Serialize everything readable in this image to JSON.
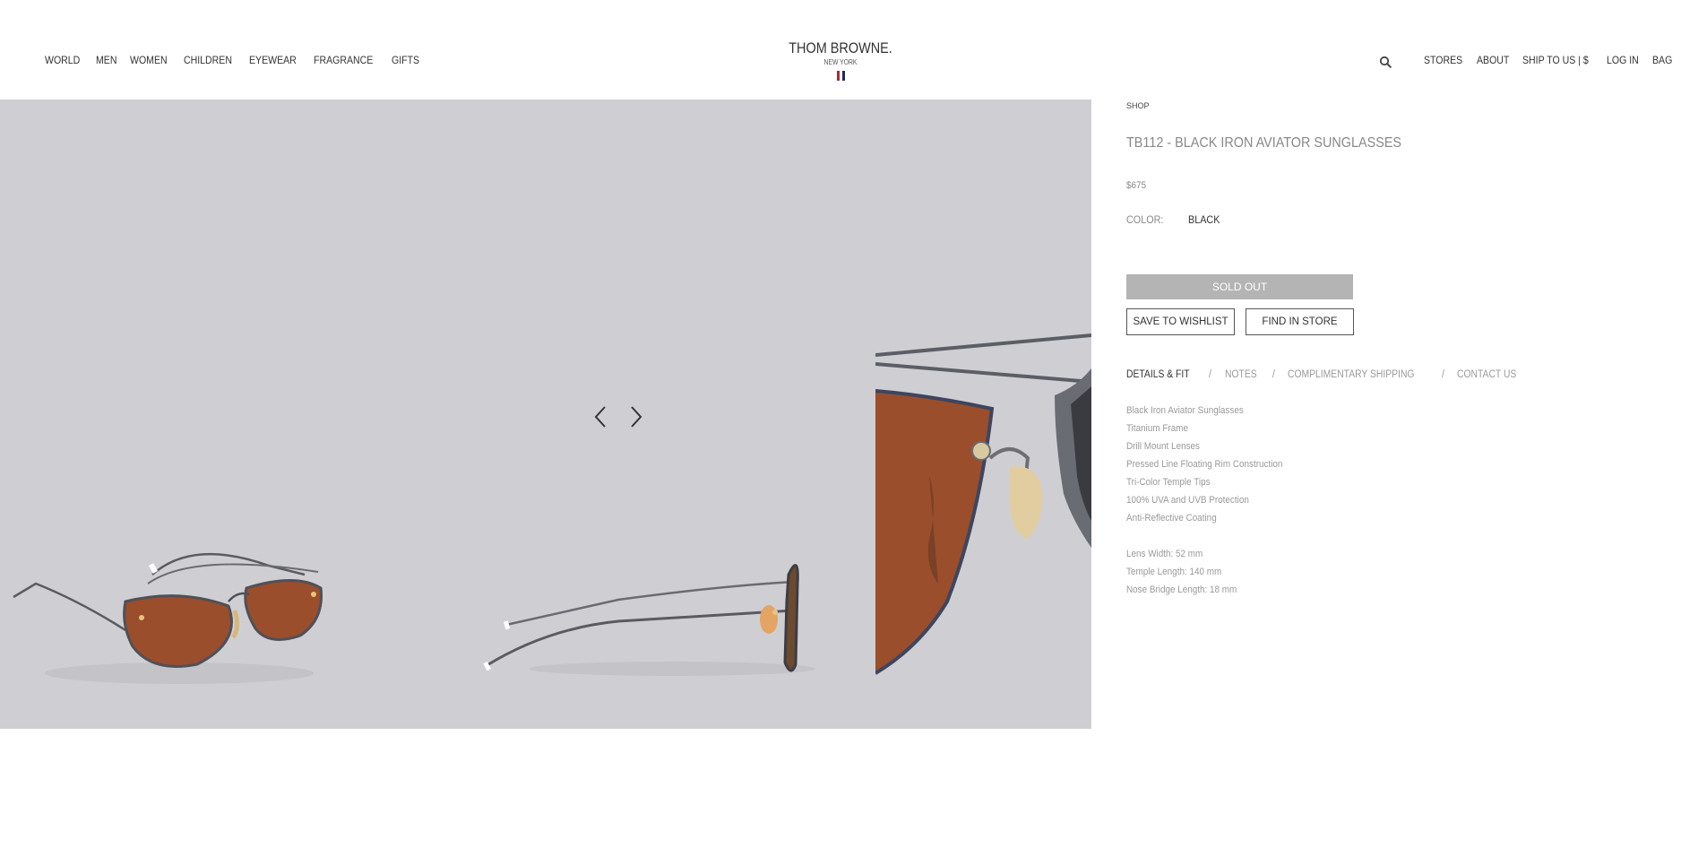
{
  "header": {
    "nav_left": [
      "WORLD",
      "MEN",
      "WOMEN",
      "CHILDREN",
      "EYEWEAR",
      "FRAGRANCE",
      "GIFTS"
    ],
    "logo_name": "THOM BROWNE.",
    "logo_sub": "NEW YORK",
    "flag_colors": [
      "#b0263a",
      "#ffffff",
      "#1e2a5a"
    ],
    "search_icon": "search-icon",
    "nav_right": [
      "STORES",
      "ABOUT",
      "SHIP TO US | $",
      "LOG IN",
      "BAG"
    ]
  },
  "gallery": {
    "background": "#cfcfd3",
    "prev_icon": "chevron-left-icon",
    "next_icon": "chevron-right-icon"
  },
  "product": {
    "breadcrumb": "SHOP",
    "title": "TB112 - BLACK IRON AVIATOR SUNGLASSES",
    "price": "$675",
    "color_label": "COLOR:",
    "color_value": "BLACK",
    "sold_out_label": "SOLD OUT",
    "wishlist_label": "SAVE TO WISHLIST",
    "find_store_label": "FIND IN STORE",
    "tabs": [
      {
        "label": "DETAILS & FIT",
        "active": true
      },
      {
        "label": "NOTES",
        "active": false
      },
      {
        "label": "COMPLIMENTARY SHIPPING",
        "active": false
      },
      {
        "label": "CONTACT US",
        "active": false
      }
    ],
    "tab_separator": "/",
    "details": [
      "Black Iron Aviator Sunglasses",
      "Titanium Frame",
      "Drill Mount Lenses",
      "Pressed Line Floating Rim Construction",
      "Tri-Color Temple Tips",
      "100% UVA and UVB Protection",
      "Anti-Reflective Coating"
    ],
    "specs": [
      "Lens Width: 52 mm",
      "Temple Length: 140 mm",
      "Nose Bridge Length: 18 mm"
    ]
  }
}
